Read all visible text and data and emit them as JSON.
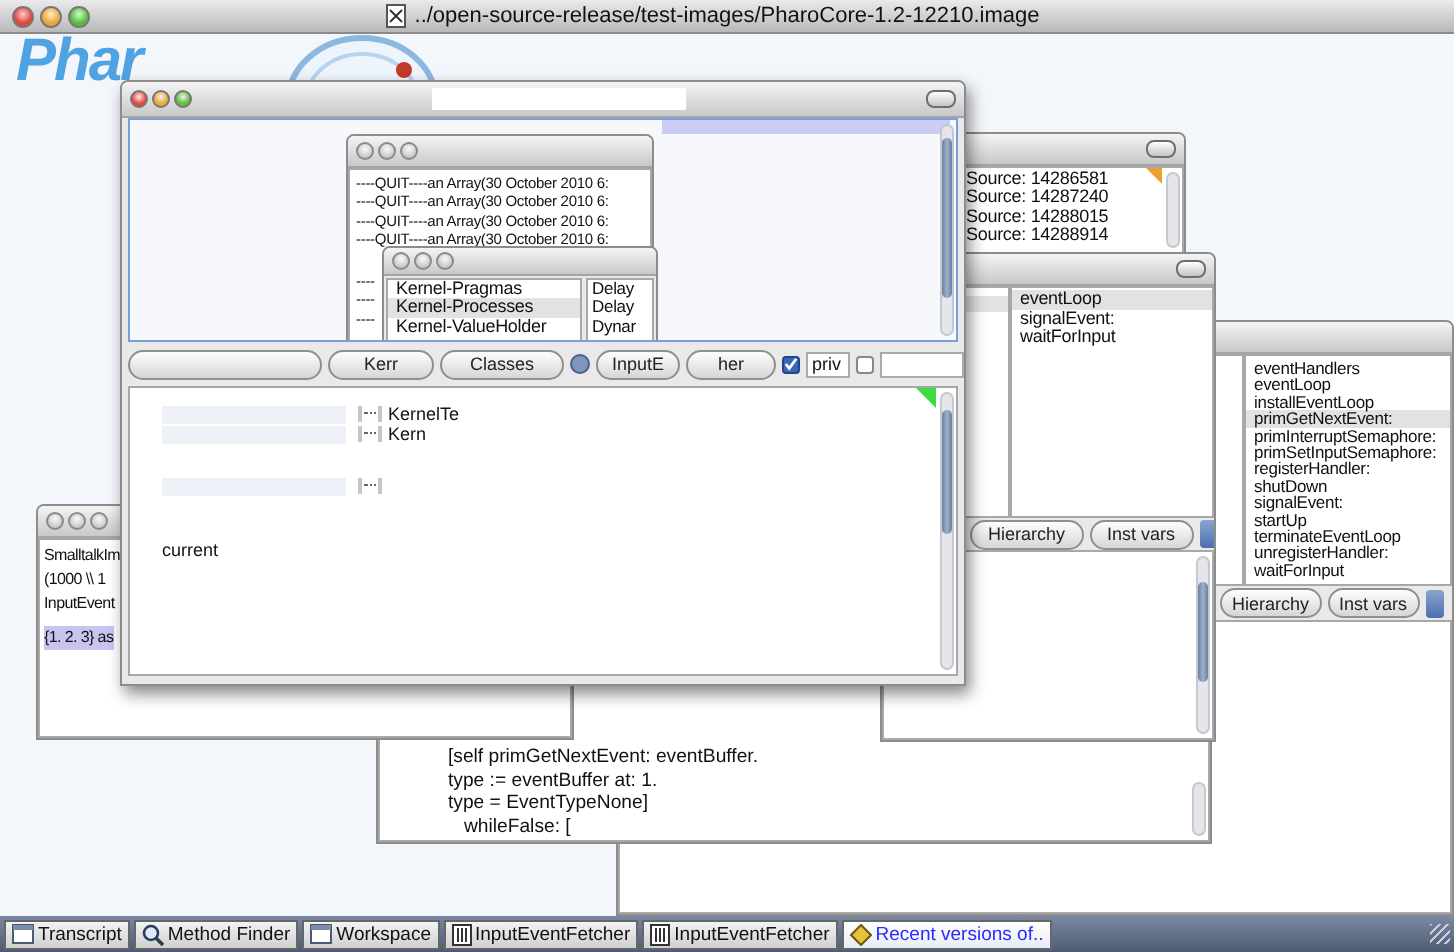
{
  "host_window": {
    "title": "../open-source-release/test-images/PharoCore-1.2-12210.image"
  },
  "logo": {
    "text": "Phar"
  },
  "right_browser": {
    "methods": [
      {
        "label": "eventHandlers",
        "selected": false
      },
      {
        "label": "eventLoop",
        "selected": false
      },
      {
        "label": "installEventLoop",
        "selected": false
      },
      {
        "label": "primGetNextEvent:",
        "selected": true
      },
      {
        "label": "primInterruptSemaphore:",
        "selected": false
      },
      {
        "label": "primSetInputSemaphore:",
        "selected": false
      },
      {
        "label": "registerHandler:",
        "selected": false
      },
      {
        "label": "shutDown",
        "selected": false
      },
      {
        "label": "signalEvent:",
        "selected": false
      },
      {
        "label": "startUp",
        "selected": false
      },
      {
        "label": "terminateEventLoop",
        "selected": false
      },
      {
        "label": "unregisterHandler:",
        "selected": false
      },
      {
        "label": "waitForInput",
        "selected": false
      }
    ],
    "buttons": [
      "Hierarchy",
      "Inst vars"
    ]
  },
  "code_window": {
    "lines": [
      "[self primGetNextEvent: eventBuffer.",
      "type := eventBuffer at: 1.",
      "type = EventTypeNone]",
      "\twhileFalse: ["
    ]
  },
  "source_window": {
    "lines": [
      "Source: 14286581",
      "Source: 14287240",
      "Source: 14288015",
      "Source: 14288914"
    ]
  },
  "mid_browser": {
    "methods": [
      {
        "label": "eventLoop",
        "selected": true
      },
      {
        "label": "signalEvent:",
        "selected": false
      },
      {
        "label": "waitForInput",
        "selected": false
      }
    ],
    "buttons": [
      "Hierarchy",
      "Inst vars"
    ]
  },
  "workspace": {
    "lines": [
      "SmalltalkIm",
      "(1000 \\\\ 1",
      "InputEvent"
    ],
    "highlighted_line": "{1. 2. 3} as"
  },
  "main_browser": {
    "transcript_lines": [
      "----QUIT----an Array(30 October 2010 6:",
      "----QUIT----an Array(30 October 2010 6:",
      "----QUIT----an Array(30 October 2010 6:",
      "----QUIT----an Array(30 October 2010 6:"
    ],
    "transcript_stubs": [
      "----",
      "----",
      "----"
    ],
    "packages": [
      {
        "label": "Kernel-Pragmas",
        "selected": false
      },
      {
        "label": "Kernel-Processes",
        "selected": true
      },
      {
        "label": "Kernel-ValueHolder",
        "selected": false
      }
    ],
    "classes": [
      "Delay",
      "Delay",
      "Dynar"
    ],
    "toolbar_buttons": [
      "Kerr",
      "Classes",
      "InputE",
      "her"
    ],
    "class_radio": {
      "selected": true
    },
    "private_checkbox": {
      "checked": true,
      "label": "priv"
    },
    "second_checkbox": {
      "checked": false
    },
    "tree_lines": [
      "KernelTe",
      "Kern"
    ],
    "text_line": "current"
  },
  "taskbar": [
    {
      "label": "Transcript",
      "kind": "window",
      "selected": false
    },
    {
      "label": "Method Finder",
      "kind": "search",
      "selected": false
    },
    {
      "label": "Workspace",
      "kind": "window",
      "selected": false
    },
    {
      "label": "InputEventFetcher",
      "kind": "class",
      "selected": false
    },
    {
      "label": "InputEventFetcher",
      "kind": "class",
      "selected": false
    },
    {
      "label": "Recent versions of..",
      "kind": "versions",
      "selected": true
    }
  ]
}
